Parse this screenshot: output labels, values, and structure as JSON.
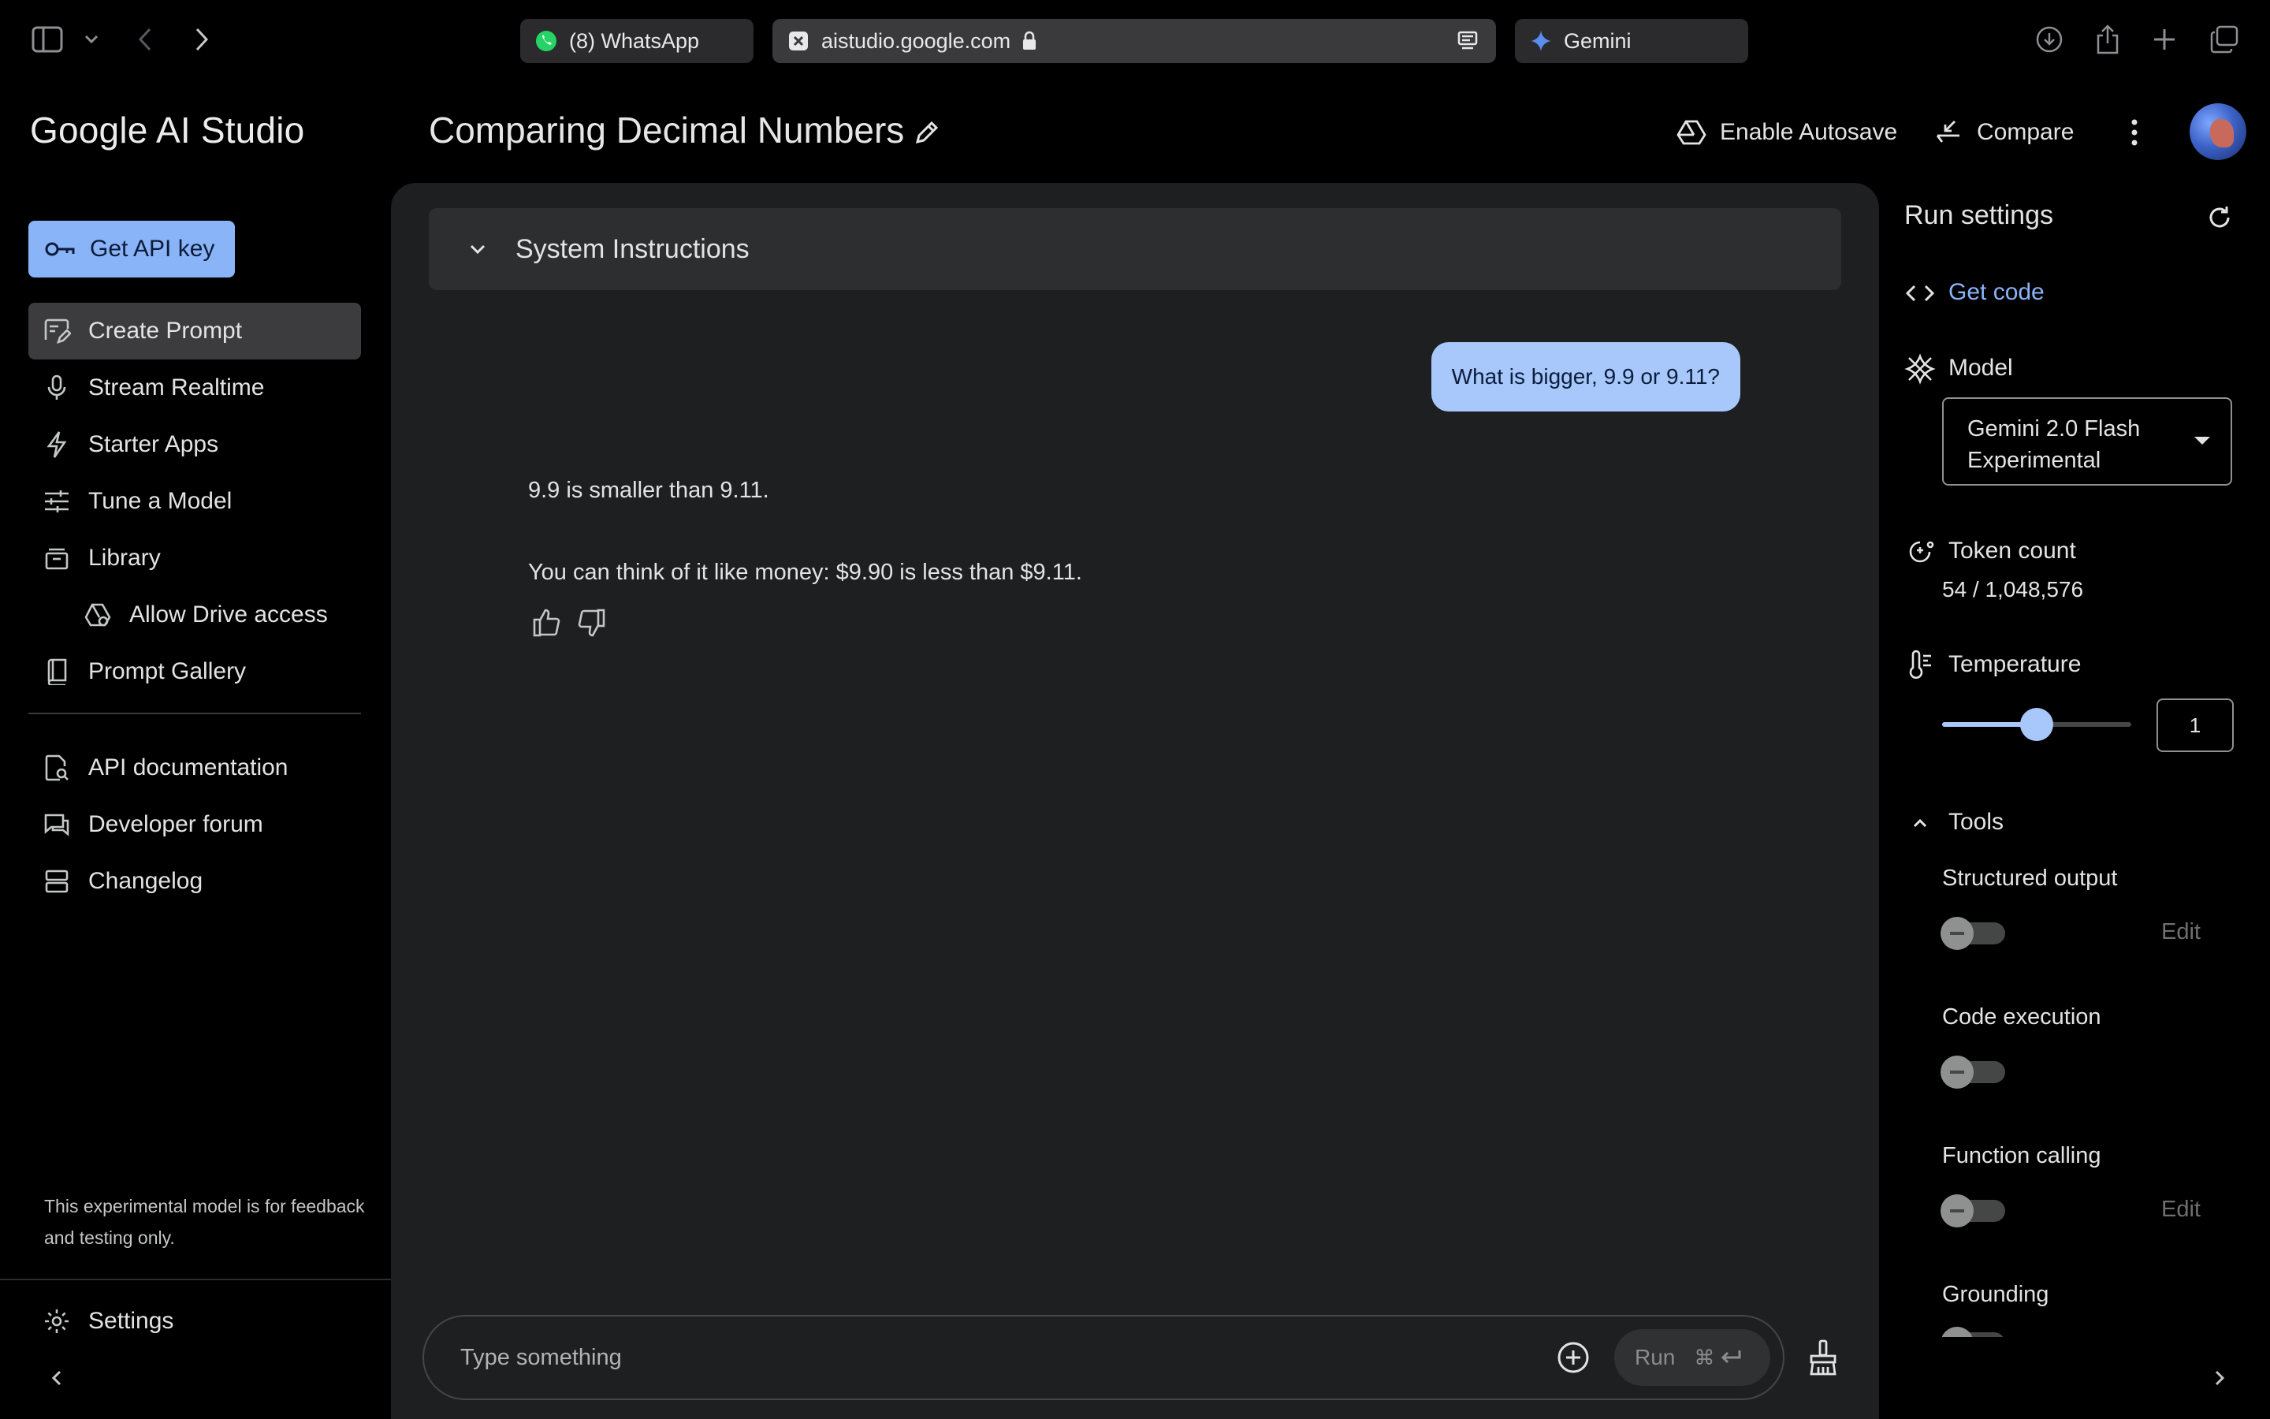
{
  "browser": {
    "tabs": [
      {
        "label": "(8) WhatsApp",
        "icon": "whatsapp-icon"
      },
      {
        "label": "aistudio.google.com",
        "icon": "aistudio-favicon"
      },
      {
        "label": "Gemini",
        "icon": "gemini-sparkle-icon"
      }
    ]
  },
  "header": {
    "brand": "Google AI Studio",
    "title": "Comparing Decimal Numbers",
    "autosave_label": "Enable Autosave",
    "compare_label": "Compare"
  },
  "sidebar": {
    "api_key_label": "Get API key",
    "items": [
      {
        "label": "Create Prompt",
        "icon": "create-prompt-icon"
      },
      {
        "label": "Stream Realtime",
        "icon": "microphone-icon"
      },
      {
        "label": "Starter Apps",
        "icon": "bolt-icon"
      },
      {
        "label": "Tune a Model",
        "icon": "tune-icon"
      },
      {
        "label": "Library",
        "icon": "library-icon"
      },
      {
        "label": "Allow Drive access",
        "icon": "drive-icon"
      },
      {
        "label": "Prompt Gallery",
        "icon": "book-icon"
      }
    ],
    "links": [
      {
        "label": "API documentation",
        "icon": "doc-search-icon"
      },
      {
        "label": "Developer forum",
        "icon": "forum-icon"
      },
      {
        "label": "Changelog",
        "icon": "changelog-icon"
      }
    ],
    "disclaimer": "This experimental model is for feedback and testing only.",
    "settings_label": "Settings"
  },
  "chat": {
    "system_instructions_label": "System Instructions",
    "user_message": "What is bigger, 9.9 or 9.11?",
    "model_reply": [
      "9.9 is smaller than 9.11.",
      "You can think of it like money: $9.90 is less than $9.11."
    ],
    "composer_placeholder": "Type something",
    "run_label": "Run",
    "run_shortcut": "⌘"
  },
  "run_settings": {
    "title": "Run settings",
    "get_code_label": "Get code",
    "model_label": "Model",
    "model_value": "Gemini 2.0 Flash Experimental",
    "token_count_label": "Token count",
    "token_count_value": "54 / 1,048,576",
    "temperature_label": "Temperature",
    "temperature_value": "1",
    "temperature_fraction": 0.5,
    "tools_label": "Tools",
    "tools": [
      {
        "label": "Structured output",
        "enabled": false,
        "edit_label": "Edit"
      },
      {
        "label": "Code execution",
        "enabled": false
      },
      {
        "label": "Function calling",
        "enabled": false,
        "edit_label": "Edit"
      },
      {
        "label": "Grounding",
        "enabled": false
      }
    ]
  },
  "colors": {
    "accent": "#8ab4f8",
    "user_bubble": "#a8c7fa",
    "panel": "#1e1f20",
    "background": "#000000"
  }
}
